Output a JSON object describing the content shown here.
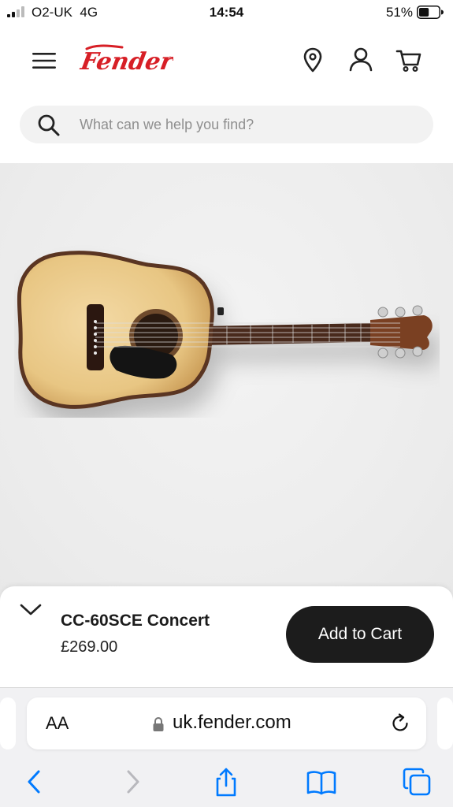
{
  "status_bar": {
    "carrier": "O2-UK",
    "network": "4G",
    "time": "14:54",
    "battery_percent": "51%",
    "battery_level": 0.51
  },
  "header": {
    "logo_text": "Fender",
    "brand_color": "#d71f26",
    "icons": [
      "menu-icon",
      "location-pin-icon",
      "account-icon",
      "cart-icon"
    ]
  },
  "search": {
    "placeholder": "What can we help you find?",
    "value": ""
  },
  "product": {
    "name": "CC-60SCE Concert",
    "price": "£269.00",
    "add_to_cart_label": "Add to Cart"
  },
  "browser": {
    "text_size_label": "AA",
    "url": "uk.fender.com",
    "accent_color": "#007aff",
    "icons": [
      "back-icon",
      "forward-icon",
      "share-icon",
      "bookmarks-icon",
      "tabs-icon"
    ]
  }
}
